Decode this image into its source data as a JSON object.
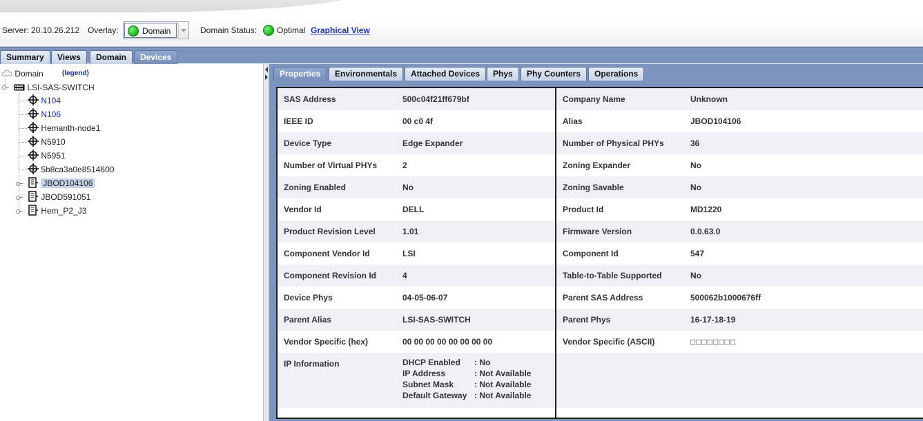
{
  "header": {
    "server_label": "Server: 20.10.26.212",
    "overlay_label": "Overlay:",
    "overlay_value": "Domain",
    "domain_status_label": "Domain Status:",
    "domain_status_value": "Optimal",
    "graphical_view_link": "Graphical View",
    "status_color": "#2ec02e"
  },
  "main_tabs": [
    {
      "label": "Summary",
      "active": false
    },
    {
      "label": "Views",
      "active": false
    },
    {
      "label": "Domain",
      "active": false
    },
    {
      "label": "Devices",
      "active": true
    }
  ],
  "tree": {
    "root_label": "Domain",
    "legend_label": "(legend)",
    "switch_label": "LSI-SAS-SWITCH",
    "nodes": [
      {
        "label": "N104",
        "icon": "initiator-icon"
      },
      {
        "label": "N106",
        "icon": "initiator-icon"
      },
      {
        "label": "Hemanth-node1",
        "icon": "initiator-icon"
      },
      {
        "label": "N5910",
        "icon": "initiator-icon"
      },
      {
        "label": "N5951",
        "icon": "initiator-icon"
      },
      {
        "label": "5b8ca3a0e8514600",
        "icon": "initiator-icon"
      },
      {
        "label": "JBOD104106",
        "icon": "jbod-icon",
        "selected": true
      },
      {
        "label": "JBOD591051",
        "icon": "jbod-icon"
      },
      {
        "label": "Hem_P2_J3",
        "icon": "jbod-icon"
      }
    ]
  },
  "sub_tabs": [
    {
      "label": "Properties",
      "active": true
    },
    {
      "label": "Environmentals",
      "active": false
    },
    {
      "label": "Attached Devices",
      "active": false
    },
    {
      "label": "Phys",
      "active": false
    },
    {
      "label": "Phy Counters",
      "active": false
    },
    {
      "label": "Operations",
      "active": false
    }
  ],
  "properties_left": [
    {
      "key": "SAS Address",
      "value": "500c04f21ff679bf"
    },
    {
      "key": "IEEE ID",
      "value": "00 c0 4f"
    },
    {
      "key": "Device Type",
      "value": "Edge Expander"
    },
    {
      "key": "Number of Virtual PHYs",
      "value": "2"
    },
    {
      "key": "Zoning Enabled",
      "value": "No"
    },
    {
      "key": "Vendor Id",
      "value": "DELL"
    },
    {
      "key": "Product Revision Level",
      "value": "1.01"
    },
    {
      "key": "Component Vendor Id",
      "value": "LSI"
    },
    {
      "key": "Component Revision Id",
      "value": "4"
    },
    {
      "key": "Device Phys",
      "value": "04-05-06-07"
    },
    {
      "key": "Parent Alias",
      "value": "LSI-SAS-SWITCH"
    },
    {
      "key": "Vendor Specific (hex)",
      "value": "00 00 00 00 00 00 00 00"
    }
  ],
  "properties_right": [
    {
      "key": "Company Name",
      "value": "Unknown"
    },
    {
      "key": "Alias",
      "value": "JBOD104106"
    },
    {
      "key": "Number of Physical PHYs",
      "value": "36"
    },
    {
      "key": "Zoning Expander",
      "value": "No"
    },
    {
      "key": "Zoning Savable",
      "value": "No"
    },
    {
      "key": "Product Id",
      "value": "MD1220"
    },
    {
      "key": "Firmware Version",
      "value": "0.0.63.0"
    },
    {
      "key": "Component Id",
      "value": "547"
    },
    {
      "key": "Table-to-Table Supported",
      "value": "No"
    },
    {
      "key": "Parent SAS Address",
      "value": "500062b1000676ff"
    },
    {
      "key": "Parent Phys",
      "value": "16-17-18-19"
    },
    {
      "key": "Vendor Specific (ASCII)",
      "value": "□□□□□□□□"
    }
  ],
  "ip_information": {
    "label": "IP Information",
    "rows": [
      {
        "key": "DHCP Enabled",
        "value": ": No"
      },
      {
        "key": "IP Address",
        "value": ": Not Available"
      },
      {
        "key": "Subnet Mask",
        "value": ": Not Available"
      },
      {
        "key": "Default Gateway",
        "value": ": Not Available"
      }
    ]
  }
}
